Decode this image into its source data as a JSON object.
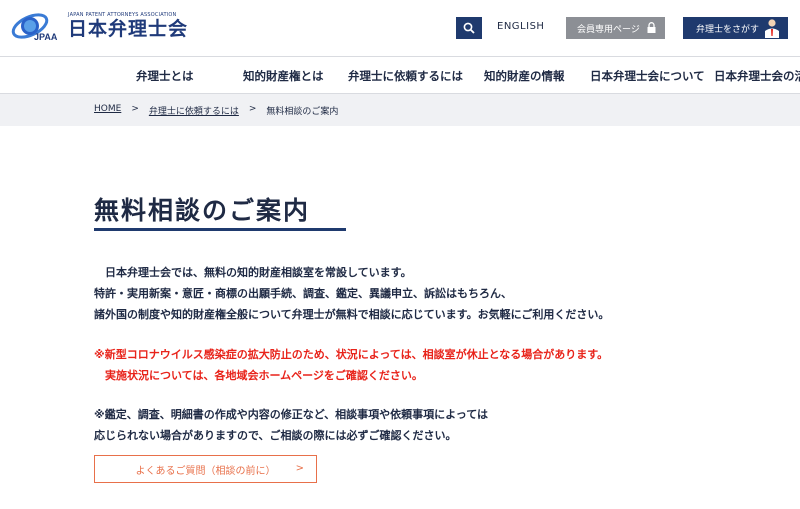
{
  "header": {
    "logo_sub": "JAPAN PATENT ATTORNEYS ASSOCIATION",
    "logo_abbr": "JPAA",
    "logo_title": "日本弁理士会",
    "english_label": "ENGLISH",
    "member_label": "会員専用ページ",
    "find_label": "弁理士をさがす",
    "icons": [
      "search-icon",
      "lock-icon",
      "person-icon"
    ]
  },
  "nav": {
    "items": [
      {
        "label": "弁理士とは"
      },
      {
        "label": "知的財産権とは"
      },
      {
        "label": "弁理士に依頼するには"
      },
      {
        "label": "知的財産の情報"
      },
      {
        "label": "日本弁理士会について"
      },
      {
        "label": "日本弁理士会の活"
      }
    ]
  },
  "breadcrumb": {
    "home": "HOME",
    "sep": ">",
    "parent": "弁理士に依頼するには",
    "current": "無料相談のご案内"
  },
  "main": {
    "title": "無料相談のご案内",
    "intro": [
      "　日本弁理士会では、無料の知的財産相談室を常設しています。",
      "特許・実用新案・意匠・商標の出願手続、調査、鑑定、異議申立、訴訟はもちろん、",
      "諸外国の制度や知的財産権全般について弁理士が無料で相談に応じています。お気軽にご利用ください。"
    ],
    "notice": [
      "※新型コロナウイルス感染症の拡大防止のため、状況によっては、相談室が休止となる場合があります。",
      "　実施状況については、各地域会ホームページをご確認ください。"
    ],
    "note": [
      "※鑑定、調査、明細書の作成や内容の修正など、相談事項や依頼事項によっては",
      "応じられない場合がありますので、ご相談の際には必ずご確認ください。"
    ],
    "faq_label": "よくあるご質問（相談の前に）",
    "faq_arrow": ">"
  },
  "colors": {
    "navy": "#1f3a6e",
    "text": "#1f2a44",
    "red": "#e8231a",
    "orange": "#e8704a",
    "gray_button": "#8c8f95",
    "breadcrumb_bg": "#f0f1f4"
  }
}
